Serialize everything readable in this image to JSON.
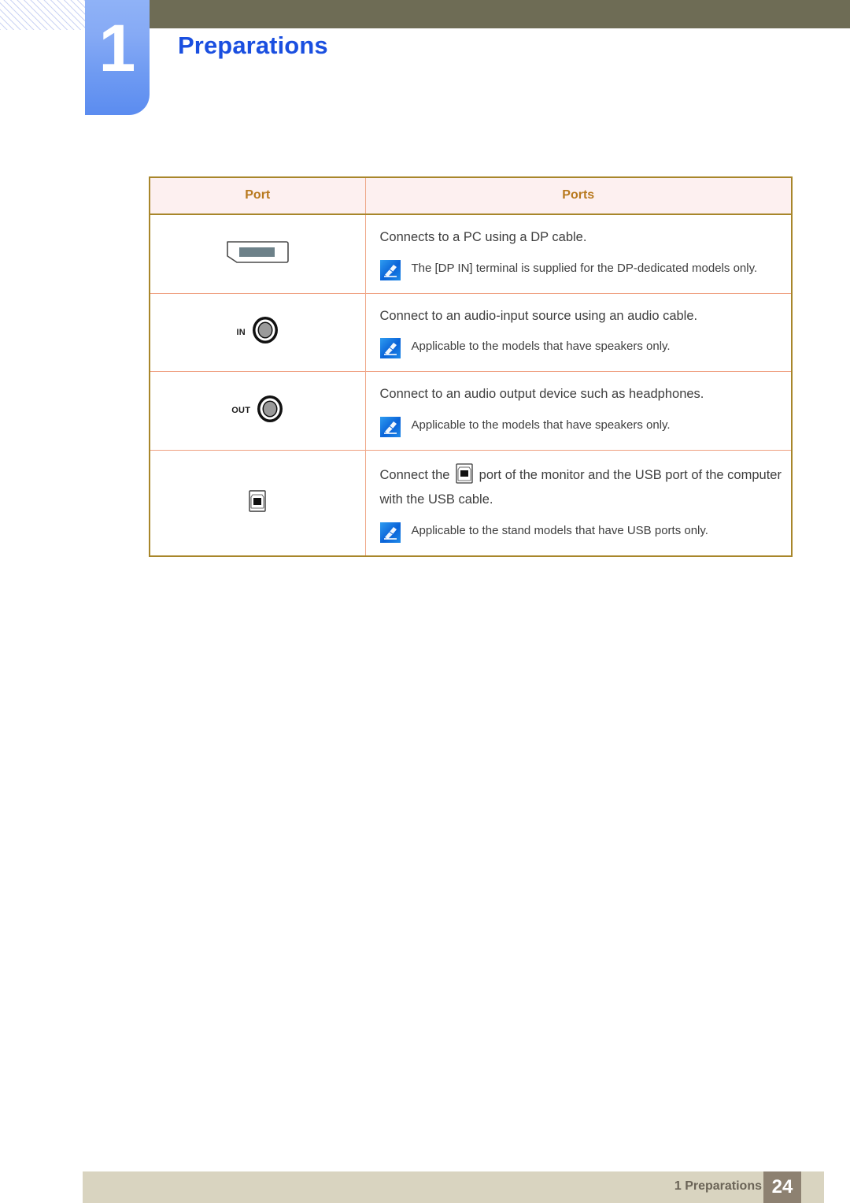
{
  "chapter": {
    "number": "1",
    "title": "Preparations"
  },
  "table": {
    "headers": {
      "port": "Port",
      "ports": "Ports"
    },
    "rows": [
      {
        "icon": "displayport-icon",
        "icon_label": "",
        "description": "Connects to a PC using a DP cable.",
        "note": "The [DP IN] terminal is supplied for the DP-dedicated models only."
      },
      {
        "icon": "audio-in-jack-icon",
        "icon_label": "IN",
        "description": "Connect to an audio-input source using an audio cable.",
        "note": "Applicable to the models that have speakers only."
      },
      {
        "icon": "audio-out-jack-icon",
        "icon_label": "OUT",
        "description": "Connect to an audio output device such as headphones.",
        "note": "Applicable to the models that have speakers only."
      },
      {
        "icon": "usb-b-port-icon",
        "icon_label": "",
        "description_part1": "Connect the",
        "description_inline_icon": "usb-b-port-inline-icon",
        "description_part2": "port of the monitor and the USB port of the computer with the USB cable.",
        "note": "Applicable to the stand models that have USB ports only."
      }
    ]
  },
  "footer": {
    "label": "1 Preparations",
    "page_number": "24"
  },
  "colors": {
    "header_band": "#6e6c55",
    "chapter_blue": "#1a4fe0",
    "tab_blue_light": "#8fb2f7",
    "tab_blue_dark": "#5b8cf0",
    "table_border": "#a8862a",
    "table_header_bg": "#fdf0f0",
    "table_header_text": "#b8791e",
    "row_divider": "#ef9f80",
    "footer_bar": "#d9d4c0",
    "footer_page_bg": "#8d8171",
    "footer_text": "#6b6457",
    "note_icon_blue": "#1a7fe0"
  }
}
